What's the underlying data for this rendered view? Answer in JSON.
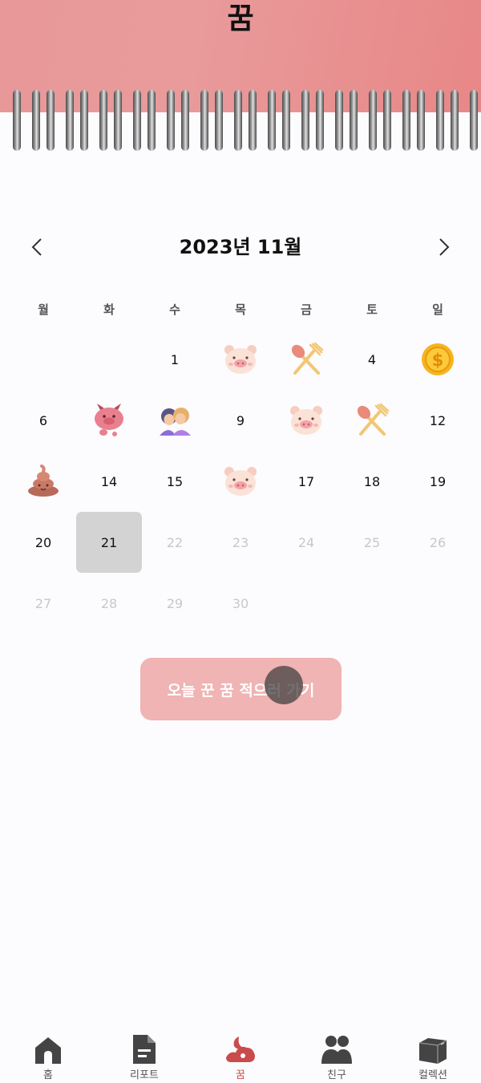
{
  "header": {
    "title": "꿈"
  },
  "calendar": {
    "month_label": "2023년 11월",
    "prev_symbol": "<",
    "next_symbol": ">",
    "weekdays": [
      "월",
      "화",
      "수",
      "목",
      "금",
      "토",
      "일"
    ],
    "selected_day": "21",
    "days": {
      "d1": "1",
      "d4": "4",
      "d6": "6",
      "d9": "9",
      "d12": "12",
      "d14": "14",
      "d15": "15",
      "d17": "17",
      "d18": "18",
      "d19": "19",
      "d20": "20",
      "d21": "21",
      "d22": "22",
      "d23": "23",
      "d24": "24",
      "d25": "25",
      "d26": "26",
      "d27": "27",
      "d28": "28",
      "d29": "29",
      "d30": "30"
    },
    "stickers": {
      "d2": "pig-icon",
      "d3": "fork-spoon-icon",
      "d5": "coin-icon",
      "d7": "pig-devil-icon",
      "d8": "couple-icon",
      "d10": "pig-icon",
      "d11": "fork-spoon-icon",
      "d13": "poop-icon",
      "d16": "pig-icon"
    }
  },
  "cta": {
    "label": "오늘 꾼 꿈 적으러 가기"
  },
  "bottom_nav": {
    "items": [
      {
        "label": "홈",
        "icon": "home-icon"
      },
      {
        "label": "리포트",
        "icon": "report-icon"
      },
      {
        "label": "꿈",
        "icon": "dream-icon"
      },
      {
        "label": "친구",
        "icon": "friends-icon"
      },
      {
        "label": "컬렉션",
        "icon": "collection-icon"
      }
    ],
    "active_color": "#c94b4b"
  },
  "colors": {
    "header": "#e89898",
    "cta": "#efb4b3",
    "selected_day_bg": "#d3d3d4",
    "future_day": "#c8c8c8"
  }
}
